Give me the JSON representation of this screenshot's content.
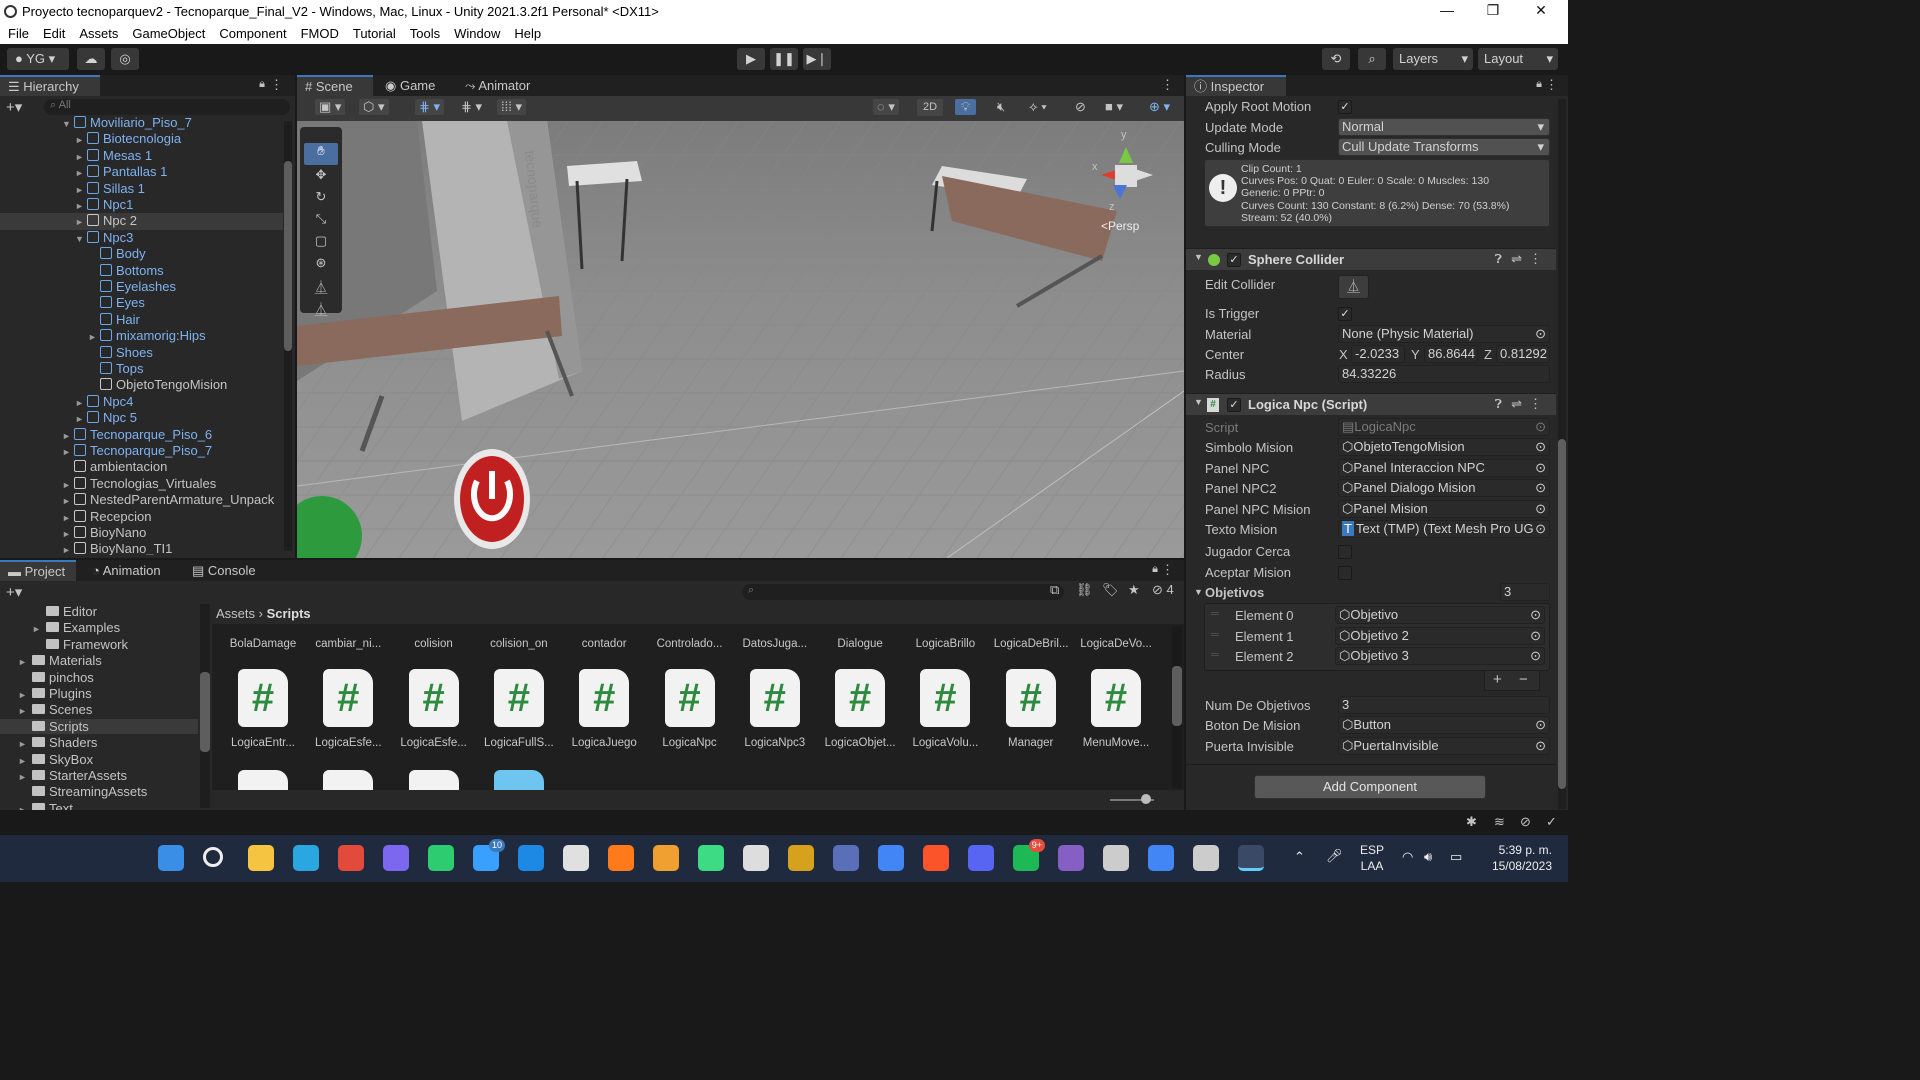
{
  "window": {
    "title": "Proyecto tecnoparquev2 - Tecnoparque_Final_V2 - Windows, Mac, Linux - Unity 2021.3.2f1 Personal* <DX11>",
    "controls": [
      "—",
      "❐",
      "✕"
    ]
  },
  "menu": [
    "File",
    "Edit",
    "Assets",
    "GameObject",
    "Component",
    "FMOD",
    "Tutorial",
    "Tools",
    "Window",
    "Help"
  ],
  "toolbar": {
    "account": "YG",
    "layers_label": "Layers",
    "layout_label": "Layout"
  },
  "hierarchy": {
    "tab_label": "Hierarchy",
    "search_placeholder": "All",
    "items": [
      {
        "label": "Moviliario_Piso_7",
        "depth": 0,
        "expand": "▼",
        "prefab": true
      },
      {
        "label": "Biotecnologia",
        "depth": 1,
        "expand": "►",
        "prefab": true
      },
      {
        "label": "Mesas 1",
        "depth": 1,
        "expand": "►",
        "prefab": true
      },
      {
        "label": "Pantallas 1",
        "depth": 1,
        "expand": "►",
        "prefab": true
      },
      {
        "label": "Sillas 1",
        "depth": 1,
        "expand": "►",
        "prefab": true
      },
      {
        "label": "Npc1",
        "depth": 1,
        "expand": "►",
        "prefab": true
      },
      {
        "label": "Npc 2",
        "depth": 1,
        "expand": "►",
        "prefab": false
      },
      {
        "label": "Npc3",
        "depth": 1,
        "expand": "▼",
        "prefab": true
      },
      {
        "label": "Body",
        "depth": 2,
        "expand": "",
        "prefab": true
      },
      {
        "label": "Bottoms",
        "depth": 2,
        "expand": "",
        "prefab": true
      },
      {
        "label": "Eyelashes",
        "depth": 2,
        "expand": "",
        "prefab": true
      },
      {
        "label": "Eyes",
        "depth": 2,
        "expand": "",
        "prefab": true
      },
      {
        "label": "Hair",
        "depth": 2,
        "expand": "",
        "prefab": true
      },
      {
        "label": "mixamorig:Hips",
        "depth": 2,
        "expand": "►",
        "prefab": true
      },
      {
        "label": "Shoes",
        "depth": 2,
        "expand": "",
        "prefab": true
      },
      {
        "label": "Tops",
        "depth": 2,
        "expand": "",
        "prefab": true
      },
      {
        "label": "ObjetoTengoMision",
        "depth": 2,
        "expand": "",
        "prefab": false
      },
      {
        "label": "Npc4",
        "depth": 1,
        "expand": "►",
        "prefab": true
      },
      {
        "label": "Npc 5",
        "depth": 1,
        "expand": "►",
        "prefab": true
      },
      {
        "label": "Tecnoparque_Piso_6",
        "depth": 0,
        "expand": "►",
        "prefab": true
      },
      {
        "label": "Tecnoparque_Piso_7",
        "depth": 0,
        "expand": "►",
        "prefab": true
      },
      {
        "label": "ambientacion",
        "depth": 0,
        "expand": "",
        "prefab": false
      },
      {
        "label": "Tecnologias_Virtuales",
        "depth": 0,
        "expand": "►",
        "prefab": false
      },
      {
        "label": "NestedParentArmature_Unpack",
        "depth": 0,
        "expand": "►",
        "prefab": false
      },
      {
        "label": "Recepcion",
        "depth": 0,
        "expand": "►",
        "prefab": false
      },
      {
        "label": "BioyNano",
        "depth": 0,
        "expand": "►",
        "prefab": false
      },
      {
        "label": "BioyNano_TI1",
        "depth": 0,
        "expand": "►",
        "prefab": false
      }
    ]
  },
  "scene": {
    "tabs": [
      "Scene",
      "Game",
      "Animator"
    ],
    "mode_2d": "2D",
    "persp_label": "<Persp",
    "gizmo_axes": [
      "y",
      "x",
      "z"
    ],
    "wall_text": "tecnoparque"
  },
  "inspector": {
    "tab_label": "Inspector",
    "animator": {
      "apply_root_motion_label": "Apply Root Motion",
      "apply_root_motion": true,
      "update_mode_label": "Update Mode",
      "update_mode": "Normal",
      "culling_mode_label": "Culling Mode",
      "culling_mode": "Cull Update Transforms",
      "info_lines": [
        "Clip Count: 1",
        "Curves Pos: 0 Quat: 0 Euler: 0 Scale: 0 Muscles: 130",
        "Generic: 0 PPtr: 0",
        "Curves Count: 130 Constant: 8 (6.2%) Dense: 70 (53.8%)",
        "Stream: 52 (40.0%)"
      ]
    },
    "sphere_collider": {
      "title": "Sphere Collider",
      "edit_collider_label": "Edit Collider",
      "is_trigger_label": "Is Trigger",
      "is_trigger": true,
      "material_label": "Material",
      "material": "None (Physic Material)",
      "center_label": "Center",
      "center": {
        "x_label": "X",
        "x": "-2.0233",
        "y_label": "Y",
        "y": "86.8644",
        "z_label": "Z",
        "z": "0.81292"
      },
      "radius_label": "Radius",
      "radius": "84.33226"
    },
    "logica_npc": {
      "title": "Logica Npc (Script)",
      "fields": [
        {
          "label": "Script",
          "value": "LogicaNpc"
        },
        {
          "label": "Simbolo Mision",
          "value": "ObjetoTengoMision"
        },
        {
          "label": "Panel NPC",
          "value": "Panel  Interaccion NPC"
        },
        {
          "label": "Panel NPC2",
          "value": "Panel Dialogo Mision"
        },
        {
          "label": "Panel NPC Mision",
          "value": "Panel Mision"
        },
        {
          "label": "Texto Mision",
          "value": "Text (TMP) (Text Mesh Pro UG"
        }
      ],
      "jugador_cerca_label": "Jugador Cerca",
      "aceptar_mision_label": "Aceptar Mision",
      "objetivos_label": "Objetivos",
      "objetivos_count": "3",
      "elements": [
        {
          "label": "Element 0",
          "value": "Objetivo"
        },
        {
          "label": "Element 1",
          "value": "Objetivo 2"
        },
        {
          "label": "Element 2",
          "value": "Objetivo 3"
        }
      ],
      "add": "+",
      "remove": "−",
      "num_objetivos_label": "Num De Objetivos",
      "num_objetivos": "3",
      "boton_label": "Boton De Mision",
      "boton_value": "Button",
      "puerta_label": "Puerta Invisible",
      "puerta_value": "PuertaInvisible"
    },
    "add_component": "Add Component"
  },
  "project": {
    "tabs": [
      "Project",
      "Animation",
      "Console"
    ],
    "hidden_count": "4",
    "breadcrumb": [
      "Assets",
      "Scripts"
    ],
    "folders": [
      {
        "label": "Editor",
        "depth": 1,
        "expand": ""
      },
      {
        "label": "Examples",
        "depth": 1,
        "expand": "►"
      },
      {
        "label": "Framework",
        "depth": 1,
        "expand": ""
      },
      {
        "label": "Materials",
        "depth": 0,
        "expand": "►"
      },
      {
        "label": "pinchos",
        "depth": 0,
        "expand": ""
      },
      {
        "label": "Plugins",
        "depth": 0,
        "expand": "►"
      },
      {
        "label": "Scenes",
        "depth": 0,
        "expand": "►"
      },
      {
        "label": "Scripts",
        "depth": 0,
        "expand": ""
      },
      {
        "label": "Shaders",
        "depth": 0,
        "expand": "►"
      },
      {
        "label": "SkyBox",
        "depth": 0,
        "expand": "►"
      },
      {
        "label": "StarterAssets",
        "depth": 0,
        "expand": "►"
      },
      {
        "label": "StreamingAssets",
        "depth": 0,
        "expand": ""
      },
      {
        "label": "Text",
        "depth": 0,
        "expand": "►"
      }
    ],
    "assets_row1": [
      "BolaDamage",
      "cambiar_ni...",
      "colision",
      "colision_on",
      "contador",
      "Controlado...",
      "DatosJuga...",
      "Dialogue",
      "LogicaBrillo",
      "LogicaDeBril...",
      "LogicaDeVo..."
    ],
    "assets_row2": [
      "LogicaEntr...",
      "LogicaEsfe...",
      "LogicaEsfe...",
      "LogicaFullS...",
      "LogicaJuego",
      "LogicaNpc",
      "LogicaNpc3",
      "LogicaObjet...",
      "LogicaVolu...",
      "Manager",
      "MenuMove..."
    ]
  },
  "taskbar": {
    "lang1": "ESP",
    "lang2": "LAA",
    "time": "5:39 p. m.",
    "date": "15/08/2023",
    "badge_xbox": "10",
    "badge_discord": "9+",
    "colors": [
      "#3a8ee6",
      "#cccccc",
      "#f5c542",
      "#2aa7e0",
      "#e24a3b",
      "#7b68ee",
      "#2ecc71",
      "#3aa0ff",
      "#1e88e5",
      "#e0e0e0",
      "#ff7a1a",
      "#f0a030",
      "#3ddc84",
      "#dddddd",
      "#d6a21e",
      "#5a6fb8",
      "#4285f4",
      "#fb542b",
      "#5865f2",
      "#1db954",
      "#865fc5",
      "#cccccc",
      "#4285f4",
      "#cccccc"
    ]
  }
}
